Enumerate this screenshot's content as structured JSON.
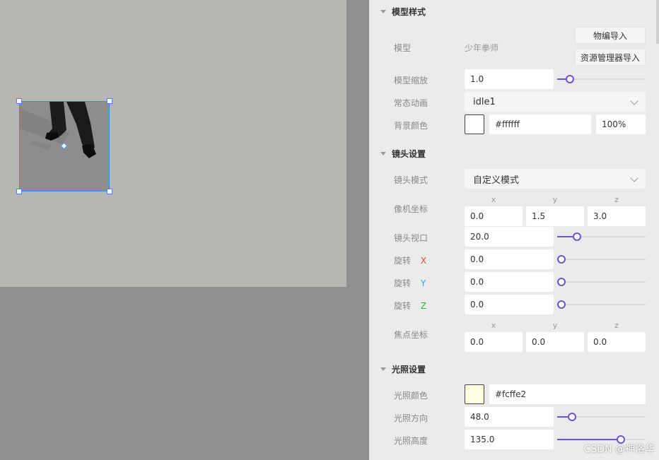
{
  "panel": {
    "model_section": {
      "title": "模型样式",
      "model_label": "模型",
      "model_value": "少年拳师",
      "import_object_button": "物编导入",
      "import_resource_button": "资源管理器导入",
      "scale_label": "模型缩放",
      "scale_value": "1.0",
      "scale_level": 0.14,
      "animation_label": "常态动画",
      "animation_value": "idle1",
      "bg_color_label": "背景颜色",
      "bg_color_hex": "#ffffff",
      "bg_opacity": "100%"
    },
    "camera_section": {
      "title": "镜头设置",
      "mode_label": "镜头模式",
      "mode_value": "自定义模式",
      "position_label": "像机坐标",
      "axis_x": "x",
      "axis_y": "y",
      "axis_z": "z",
      "position_x": "0.0",
      "position_y": "1.5",
      "position_z": "3.0",
      "fov_label": "镜头视口",
      "fov_value": "20.0",
      "fov_level": 0.22,
      "rotate_label": "旋转",
      "rotate_x_letter": "X",
      "rotate_y_letter": "Y",
      "rotate_z_letter": "Z",
      "rotate_x_value": "0.0",
      "rotate_y_value": "0.0",
      "rotate_z_value": "0.0",
      "focus_label": "焦点坐标",
      "focus_x": "0.0",
      "focus_y": "0.0",
      "focus_z": "0.0"
    },
    "light_section": {
      "title": "光照设置",
      "color_label": "光照颜色",
      "color_hex": "#fcffe2",
      "direction_label": "光照方向",
      "direction_value": "48.0",
      "direction_level": 0.17,
      "height_label": "光照高度",
      "height_value": "135.0",
      "height_level": 0.72
    }
  },
  "colors": {
    "accent": "#6f52d8",
    "selection": "#3d8bfd",
    "light_swatch": "#fcffe2",
    "bg_swatch": "#ffffff"
  },
  "watermark": "CSDN @神洛华"
}
